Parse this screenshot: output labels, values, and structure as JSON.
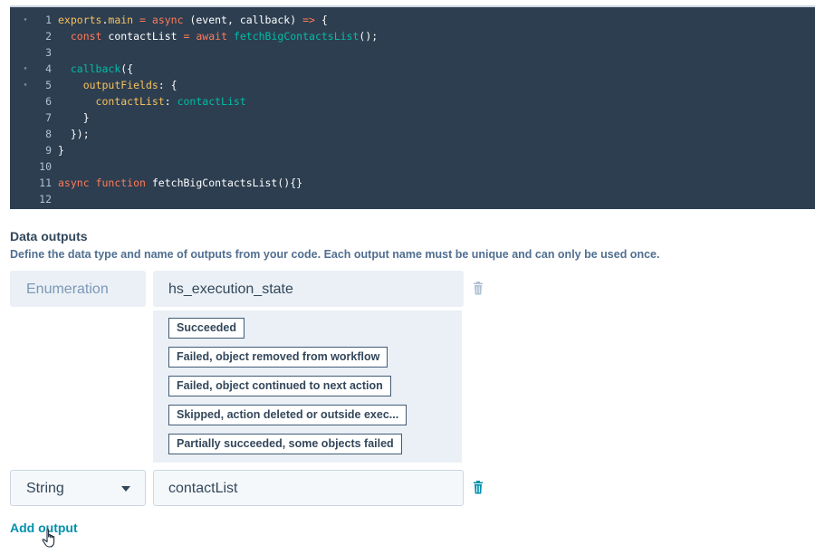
{
  "editor": {
    "lines": [
      {
        "num": "1",
        "fold": true,
        "tokens": [
          {
            "t": "exports",
            "c": "t-obj"
          },
          {
            "t": ".",
            "c": "t-plain"
          },
          {
            "t": "main",
            "c": "t-prop"
          },
          {
            "t": " = ",
            "c": "t-kw"
          },
          {
            "t": "async",
            "c": "t-kw"
          },
          {
            "t": " (event, callback) ",
            "c": "t-plain"
          },
          {
            "t": "=>",
            "c": "t-kw"
          },
          {
            "t": " {",
            "c": "t-plain"
          }
        ]
      },
      {
        "num": "2",
        "fold": false,
        "tokens": [
          {
            "t": "  ",
            "c": "t-plain"
          },
          {
            "t": "const",
            "c": "t-kw"
          },
          {
            "t": " contactList ",
            "c": "t-plain"
          },
          {
            "t": "=",
            "c": "t-kw"
          },
          {
            "t": " ",
            "c": "t-plain"
          },
          {
            "t": "await",
            "c": "t-kw"
          },
          {
            "t": " ",
            "c": "t-plain"
          },
          {
            "t": "fetchBigContactsList",
            "c": "t-fn"
          },
          {
            "t": "();",
            "c": "t-plain"
          }
        ]
      },
      {
        "num": "3",
        "fold": false,
        "tokens": []
      },
      {
        "num": "4",
        "fold": true,
        "tokens": [
          {
            "t": "  ",
            "c": "t-plain"
          },
          {
            "t": "callback",
            "c": "t-fn"
          },
          {
            "t": "({",
            "c": "t-plain"
          }
        ]
      },
      {
        "num": "5",
        "fold": true,
        "tokens": [
          {
            "t": "    ",
            "c": "t-plain"
          },
          {
            "t": "outputFields",
            "c": "t-prop"
          },
          {
            "t": ": {",
            "c": "t-plain"
          }
        ]
      },
      {
        "num": "6",
        "fold": false,
        "tokens": [
          {
            "t": "      ",
            "c": "t-plain"
          },
          {
            "t": "contactList",
            "c": "t-prop"
          },
          {
            "t": ": ",
            "c": "t-plain"
          },
          {
            "t": "contactList",
            "c": "t-var"
          }
        ]
      },
      {
        "num": "7",
        "fold": false,
        "tokens": [
          {
            "t": "    }",
            "c": "t-plain"
          }
        ]
      },
      {
        "num": "8",
        "fold": false,
        "tokens": [
          {
            "t": "  });",
            "c": "t-plain"
          }
        ]
      },
      {
        "num": "9",
        "fold": false,
        "tokens": [
          {
            "t": "}",
            "c": "t-plain"
          }
        ]
      },
      {
        "num": "10",
        "fold": false,
        "tokens": []
      },
      {
        "num": "11",
        "fold": false,
        "tokens": [
          {
            "t": "async",
            "c": "t-kw"
          },
          {
            "t": " ",
            "c": "t-plain"
          },
          {
            "t": "function",
            "c": "t-kw"
          },
          {
            "t": " fetchBigContactsList(){}",
            "c": "t-plain"
          }
        ]
      },
      {
        "num": "12",
        "fold": false,
        "tokens": []
      }
    ]
  },
  "data_outputs": {
    "title": "Data outputs",
    "description": "Define the data type and name of outputs from your code. Each output name must be unique and can only be used once.",
    "outputs": [
      {
        "type": "Enumeration",
        "name": "hs_execution_state",
        "options": [
          "Succeeded",
          "Failed, object removed from workflow",
          "Failed, object continued to next action",
          "Skipped, action deleted or outside exec...",
          "Partially succeeded, some objects failed"
        ]
      },
      {
        "type": "String",
        "name": "contactList"
      }
    ],
    "add_output_label": "Add output"
  },
  "colors": {
    "editor_bg": "#2d3e50",
    "accent_link": "#0091ae",
    "trash_icon": "#0091ae"
  },
  "icons": {
    "delete": "trash-icon",
    "fold": "fold-arrow-icon",
    "cursor": "hand-pointer-icon"
  }
}
